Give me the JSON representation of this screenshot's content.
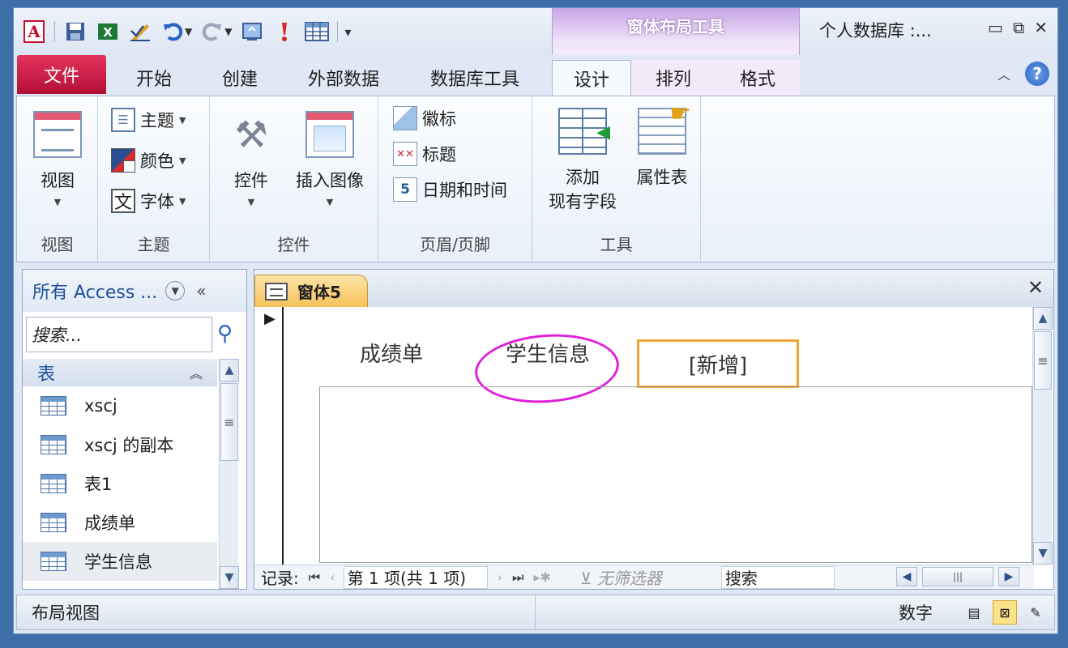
{
  "window": {
    "title": "个人数据库 :...",
    "context_tool_title": "窗体布局工具"
  },
  "quick_access": {
    "icons": [
      "access-logo-icon",
      "save-icon",
      "excel-icon",
      "edit-icon",
      "undo-icon",
      "redo-icon",
      "refresh-icon",
      "alert-icon",
      "table-icon",
      "customize-icon"
    ],
    "logo_letter": "A"
  },
  "tabs": [
    {
      "label": "文件"
    },
    {
      "label": "开始"
    },
    {
      "label": "创建"
    },
    {
      "label": "外部数据"
    },
    {
      "label": "数据库工具"
    },
    {
      "label": "设计"
    },
    {
      "label": "排列"
    },
    {
      "label": "格式"
    }
  ],
  "ribbon": {
    "view": {
      "button": "视图",
      "group": "视图"
    },
    "theme": {
      "theme": "主题",
      "color": "颜色",
      "font": "字体",
      "font_glyph": "文",
      "group": "主题"
    },
    "controls": {
      "controls": "控件",
      "insert_image": "插入图像",
      "group": "控件"
    },
    "header_footer": {
      "logo": "徽标",
      "heading": "标题",
      "datetime": "日期和时间",
      "group": "页眉/页脚"
    },
    "tools": {
      "add_fields_line1": "添加",
      "add_fields_line2": "现有字段",
      "property_sheet": "属性表",
      "group": "工具"
    }
  },
  "nav_pane": {
    "title": "所有 Access ...",
    "search_placeholder": "搜索...",
    "category": "表",
    "items": [
      {
        "label": "xscj"
      },
      {
        "label": "xscj 的副本"
      },
      {
        "label": "表1"
      },
      {
        "label": "成绩单"
      },
      {
        "label": "学生信息"
      }
    ]
  },
  "document": {
    "tab_title": "窗体5",
    "form_tabs": {
      "tab1": "成绩单",
      "tab2": "学生信息",
      "tab3": "[新增]"
    }
  },
  "record_nav": {
    "label": "记录:",
    "position": "第 1 项(共 1 项)",
    "filter": "无筛选器",
    "search": "搜索"
  },
  "status": {
    "mode": "布局视图",
    "numlock": "数字"
  },
  "colors": {
    "file_tab": "#c61a3f",
    "context_tab": "#c8a5e6",
    "annotation_circle": "#e020d8",
    "annotation_box": "#f4a436"
  }
}
